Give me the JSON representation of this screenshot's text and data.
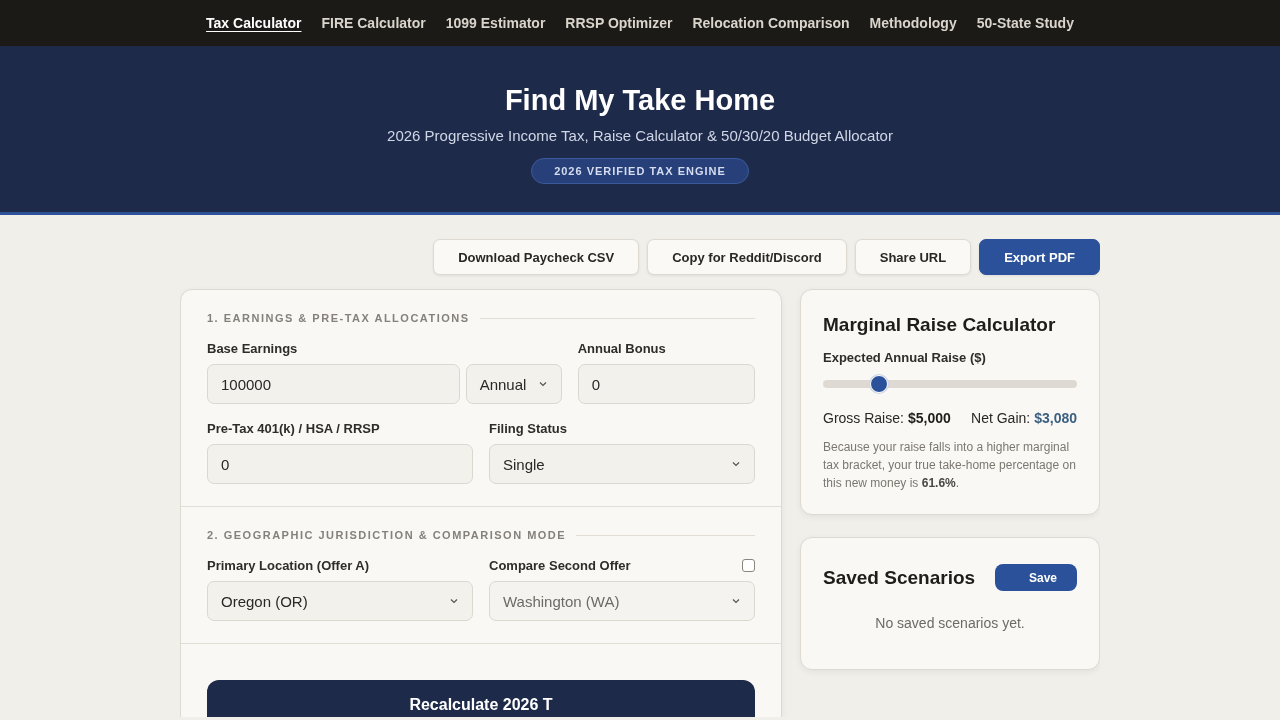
{
  "nav": [
    {
      "label": "Tax Calculator",
      "selected": true
    },
    {
      "label": "FIRE Calculator",
      "selected": false
    },
    {
      "label": "1099 Estimator",
      "selected": false
    },
    {
      "label": "RRSP Optimizer",
      "selected": false
    },
    {
      "label": "Relocation Comparison",
      "selected": false
    },
    {
      "label": "Methodology",
      "selected": false
    },
    {
      "label": "50-State Study",
      "selected": false
    }
  ],
  "hero": {
    "title": "Find My Take Home",
    "subtitle": "2026 Progressive Income Tax, Raise Calculator & 50/30/20 Budget Allocator",
    "badge": "2026 VERIFIED TAX ENGINE"
  },
  "actions": [
    {
      "label": "Download Paycheck CSV",
      "kind": "secondary"
    },
    {
      "label": "Copy for Reddit/Discord",
      "kind": "secondary"
    },
    {
      "label": "Share URL",
      "kind": "secondary"
    },
    {
      "label": "Export PDF",
      "kind": "primary"
    }
  ],
  "sections": [
    {
      "title": "1. EARNINGS & PRE-TAX ALLOCATIONS",
      "rows": [
        [
          {
            "label": "Base Earnings",
            "kind": "input",
            "value": "100000",
            "unit": "Annual"
          },
          {
            "label": "Annual Bonus",
            "kind": "input",
            "value": "0"
          }
        ],
        [
          {
            "label": "Pre-Tax 401(k) / HSA / RRSP",
            "kind": "input",
            "value": "0"
          },
          {
            "label": "Filing Status",
            "kind": "select",
            "value": "Single"
          }
        ]
      ]
    },
    {
      "title": "2. GEOGRAPHIC JURISDICTION & COMPARISON MODE",
      "rows": [
        [
          {
            "label": "Primary Location (Offer A)",
            "kind": "select",
            "value": "Oregon (OR)"
          },
          {
            "label": "Compare Second Offer",
            "kind": "select",
            "value": "Washington (WA)",
            "checked": false,
            "disabled": true
          }
        ]
      ]
    }
  ],
  "calculate_button": "Recalculate 2026 T",
  "raise": {
    "title": "Marginal Raise Calculator",
    "slider_label": "Expected Annual Raise ($)",
    "level": 0.22,
    "gross_label": "Gross Raise:",
    "gross": "$5,000",
    "net_label": "Net Gain:",
    "net": "$3,080",
    "note": "Because your raise falls into a higher marginal tax bracket, your true take-home percentage on this new money is **61.6%**."
  },
  "saved": {
    "title": "Saved Scenarios",
    "button": "Save",
    "empty": "No saved scenarios yet."
  }
}
